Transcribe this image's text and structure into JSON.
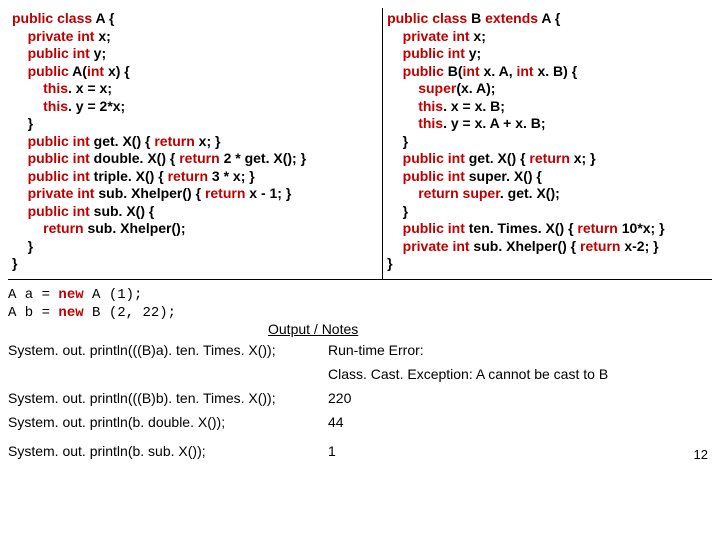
{
  "classA": {
    "l1a": "public class",
    "l1b": " A {",
    "l2a": "private int",
    "l2b": " x;",
    "l3a": "public int",
    "l3b": " y;",
    "l4a": "public",
    "l4b": " A(",
    "l4c": "int",
    "l4d": " x) {",
    "l5a": "this",
    "l5b": ". x = x;",
    "l6a": "this",
    "l6b": ". y = 2*x;",
    "l7": "}",
    "l8a": "public int",
    "l8b": " get. X() { ",
    "l8c": "return",
    "l8d": " x; }",
    "l9a": "public int",
    "l9b": " double. X() { ",
    "l9c": "return",
    "l9d": " 2 * get. X(); }",
    "l10a": "public int",
    "l10b": " triple. X() { ",
    "l10c": "return",
    "l10d": " 3 * x; }",
    "l11a": "private int",
    "l11b": " sub. Xhelper() { ",
    "l11c": "return",
    "l11d": " x - 1; }",
    "l12a": "public int",
    "l12b": " sub. X() {",
    "l13a": "return",
    "l13b": " sub. Xhelper();",
    "l14": "}",
    "l15": "}"
  },
  "classB": {
    "l1a": "public class",
    "l1b": " B ",
    "l1c": "extends",
    "l1d": " A {",
    "l2a": "private int",
    "l2b": " x;",
    "l3a": "public int",
    "l3b": " y;",
    "l4a": "public",
    "l4b": " B(",
    "l4c": "int",
    "l4d": " x. A, ",
    "l4e": "int",
    "l4f": " x. B) {",
    "l5a": "super",
    "l5b": "(x. A);",
    "l6a": "this",
    "l6b": ". x = x. B;",
    "l7a": "this",
    "l7b": ". y = x. A + x. B;",
    "l8": "}",
    "l9a": "public int",
    "l9b": " get. X() { ",
    "l9c": "return",
    "l9d": " x; }",
    "l10a": "public int",
    "l10b": " super. X() {",
    "l11a": "return super",
    "l11b": ". get. X();",
    "l12": "}",
    "l13a": "public int",
    "l13b": " ten. Times. X() { ",
    "l13c": "return",
    "l13d": " 10*x; }",
    "l14a": "private int",
    "l14b": " sub. Xhelper() { ",
    "l14c": "return",
    "l14d": " x-2; }",
    "l15": "}"
  },
  "decl": {
    "l1a": "A a = ",
    "l1b": "new",
    "l1c": " A (1);",
    "l2a": "A b = ",
    "l2b": "new",
    "l2c": " B (2, 22);"
  },
  "output_header": "Output / Notes",
  "stmts": {
    "s1": "System. out. println(((B)a). ten. Times. X());",
    "s2": "System. out. println(((B)b). ten. Times. X());",
    "s3": "System. out. println(b. double. X());",
    "s4": "System. out. println(b. sub. X());"
  },
  "out": {
    "o1a": "Run-time Error:",
    "o1b": "Class. Cast. Exception:   A cannot be cast to B",
    "o2": "220",
    "o3": "44",
    "o4": "1"
  },
  "page_number": "12"
}
